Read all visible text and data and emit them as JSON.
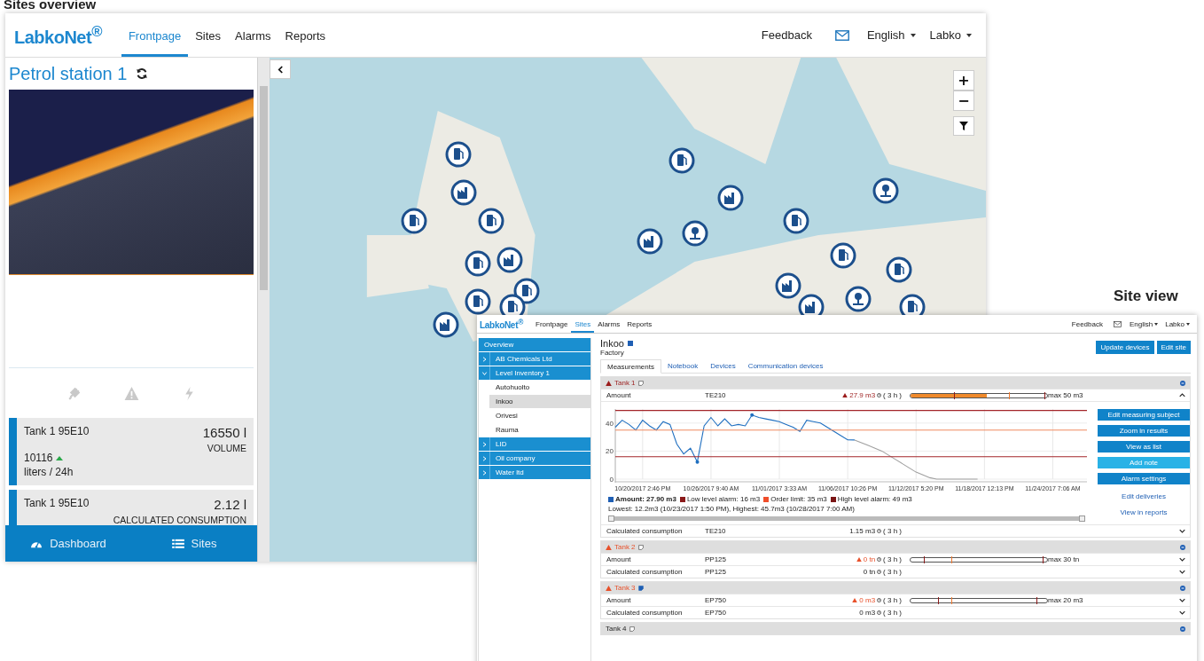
{
  "page_heading": "Sites overview",
  "overview_window": {
    "logo": "LabkoNet$^{®}$",
    "nav": [
      {
        "label": "Frontpage",
        "selected": true
      },
      {
        "label": "Sites",
        "selected": false
      },
      {
        "label": "Alarms",
        "selected": false
      },
      {
        "label": "Reports",
        "selected": false
      }
    ],
    "header_links": {
      "feedback": "Feedback",
      "language": "English",
      "user": "Labko"
    },
    "site_title": "Petrol station 1",
    "cards": [
      {
        "name": "Tank 1 95E10",
        "value": "16550 l",
        "caption": "VOLUME",
        "change": "10116",
        "trend_up": true,
        "change_unit": "liters / 24h"
      },
      {
        "name": "Tank 1 95E10",
        "value": "2.12 l",
        "caption": "CALCULATED CONSUMPTION"
      }
    ],
    "bottom_nav": [
      {
        "label": "Dashboard",
        "kind": "dashboard"
      },
      {
        "label": "Sites",
        "kind": "list"
      }
    ],
    "map_controls": {
      "zoom_in": "+",
      "zoom_out": "−"
    }
  },
  "site_view_label": "Site view",
  "site_window": {
    "logo": "LabkoNet$^{®}$",
    "nav": [
      {
        "label": "Frontpage",
        "selected": false
      },
      {
        "label": "Sites",
        "selected": true
      },
      {
        "label": "Alarms",
        "selected": false
      },
      {
        "label": "Reports",
        "selected": false
      }
    ],
    "header_links": {
      "feedback": "Feedback",
      "language": "English",
      "user": "Labko"
    },
    "sidebar": [
      {
        "label": "Overview",
        "kind": "header"
      },
      {
        "label": "AB Chemicals Ltd",
        "kind": "group",
        "expanded": false
      },
      {
        "label": "Level Inventory 1",
        "kind": "group",
        "expanded": true,
        "children": [
          {
            "label": "Autohuolto",
            "selected": false
          },
          {
            "label": "Inkoo",
            "selected": true
          },
          {
            "label": "Orivesi",
            "selected": false
          },
          {
            "label": "Rauma",
            "selected": false
          }
        ]
      },
      {
        "label": "LID",
        "kind": "group",
        "expanded": false
      },
      {
        "label": "Oil company",
        "kind": "group",
        "expanded": false
      },
      {
        "label": "Water ltd",
        "kind": "group",
        "expanded": false
      }
    ],
    "title": "Inkoo",
    "subtitle": "Factory",
    "actions": [
      "Update devices",
      "Edit site"
    ],
    "tabs": [
      {
        "label": "Measurements",
        "selected": true
      },
      {
        "label": "Notebook",
        "selected": false
      },
      {
        "label": "Devices",
        "selected": false
      },
      {
        "label": "Communication devices",
        "selected": false
      }
    ],
    "tanks": [
      {
        "name": "Tank 1",
        "alarm": true,
        "color": "#9b1c1c",
        "note_filled": false,
        "rows": [
          {
            "label": "Amount",
            "device": "TE210",
            "reading": "27.9 m3",
            "alarm": true,
            "age": "( 3 h )",
            "level": 0.56,
            "markers": [
              {
                "level": 0.32,
                "kind": "alarm"
              },
              {
                "level": 0.72,
                "kind": "order"
              },
              {
                "level": 0.98,
                "kind": "alarm"
              }
            ],
            "max": "max 50 m3",
            "expanded": true,
            "details": {
              "chart_data": {
                "type": "line",
                "categories": [
                  null,
                  null,
                  null,
                  null,
                  "10/20/2017 2:46 PM",
                  null,
                  null,
                  null,
                  null,
                  null,
                  null,
                  null,
                  null,
                  null,
                  "10/26/2017 9:40 AM",
                  null,
                  null,
                  null,
                  null,
                  null,
                  null,
                  null,
                  null,
                  null,
                  "11/01/2017 3:33 AM",
                  null,
                  null,
                  null,
                  null,
                  null,
                  null,
                  null,
                  null,
                  null,
                  "11/06/2017 10:26 PM",
                  null,
                  null,
                  null,
                  null,
                  null,
                  null,
                  null,
                  null,
                  null,
                  "11/12/2017 5:20 PM",
                  null,
                  null,
                  null,
                  null,
                  null,
                  null,
                  null,
                  null,
                  null,
                  "11/18/2017 12:13 PM",
                  null,
                  null,
                  null,
                  null,
                  null,
                  null,
                  null,
                  null,
                  null,
                  "11/24/2017 7:06 AM",
                  null,
                  null,
                  null,
                  null,
                  null
                ],
                "series": [
                  {
                    "color": "#1f6fc0",
                    "values": [
                      37,
                      42,
                      39,
                      35,
                      42,
                      38,
                      35,
                      41,
                      39,
                      25,
                      18,
                      22,
                      12.2,
                      38,
                      44,
                      38,
                      43,
                      38,
                      39,
                      38,
                      45.7,
                      44,
                      43,
                      42,
                      41,
                      39,
                      37,
                      34,
                      42,
                      41,
                      40,
                      37,
                      34,
                      31,
                      28,
                      27.9,
                      null,
                      null,
                      null,
                      null,
                      null,
                      null,
                      null,
                      null,
                      null,
                      null,
                      null,
                      null,
                      null,
                      null,
                      null,
                      null,
                      null,
                      null,
                      null,
                      null,
                      null,
                      null,
                      null,
                      null,
                      null,
                      null,
                      null,
                      null,
                      null,
                      null,
                      null,
                      null,
                      null,
                      null
                    ]
                  },
                  {
                    "color": "#a0a0a0",
                    "values": [
                      null,
                      null,
                      null,
                      null,
                      null,
                      null,
                      null,
                      null,
                      null,
                      null,
                      null,
                      null,
                      null,
                      null,
                      null,
                      null,
                      null,
                      null,
                      null,
                      null,
                      null,
                      null,
                      null,
                      null,
                      null,
                      null,
                      null,
                      null,
                      null,
                      null,
                      null,
                      null,
                      null,
                      null,
                      null,
                      27.9,
                      26,
                      24,
                      22,
                      20,
                      17,
                      14,
                      11,
                      8,
                      5,
                      3,
                      1,
                      0,
                      0,
                      0,
                      0,
                      0,
                      0,
                      0,
                      null,
                      null,
                      null,
                      null,
                      null,
                      null,
                      null,
                      null,
                      null,
                      null,
                      null,
                      null,
                      null,
                      null,
                      null,
                      null
                    ]
                  },
                  {
                    "color": "#a3262a",
                    "values": [
                      16,
                      16,
                      16,
                      16,
                      16,
                      16,
                      16,
                      16,
                      16,
                      16,
                      16,
                      16,
                      16,
                      16,
                      16,
                      16,
                      16,
                      16,
                      16,
                      16,
                      16,
                      16,
                      16,
                      16,
                      16,
                      16,
                      16,
                      16,
                      16,
                      16,
                      16,
                      16,
                      16,
                      16,
                      16,
                      16,
                      16,
                      16,
                      16,
                      16,
                      16,
                      16,
                      16,
                      16,
                      16,
                      16,
                      16,
                      16,
                      16,
                      16,
                      16,
                      16,
                      16,
                      16,
                      16,
                      16,
                      16,
                      16,
                      16,
                      16,
                      16,
                      16,
                      16,
                      16,
                      16,
                      16,
                      16,
                      16,
                      16,
                      16
                    ]
                  },
                  {
                    "color": "#f08a5f",
                    "values": [
                      35,
                      35,
                      35,
                      35,
                      35,
                      35,
                      35,
                      35,
                      35,
                      35,
                      35,
                      35,
                      35,
                      35,
                      35,
                      35,
                      35,
                      35,
                      35,
                      35,
                      35,
                      35,
                      35,
                      35,
                      35,
                      35,
                      35,
                      35,
                      35,
                      35,
                      35,
                      35,
                      35,
                      35,
                      35,
                      35,
                      35,
                      35,
                      35,
                      35,
                      35,
                      35,
                      35,
                      35,
                      35,
                      35,
                      35,
                      35,
                      35,
                      35,
                      35,
                      35,
                      35,
                      35,
                      35,
                      35,
                      35,
                      35,
                      35,
                      35,
                      35,
                      35,
                      35,
                      35,
                      35,
                      35,
                      35,
                      35,
                      35,
                      35
                    ]
                  },
                  {
                    "color": "#a3262a",
                    "values": [
                      49,
                      49,
                      49,
                      49,
                      49,
                      49,
                      49,
                      49,
                      49,
                      49,
                      49,
                      49,
                      49,
                      49,
                      49,
                      49,
                      49,
                      49,
                      49,
                      49,
                      49,
                      49,
                      49,
                      49,
                      49,
                      49,
                      49,
                      49,
                      49,
                      49,
                      49,
                      49,
                      49,
                      49,
                      49,
                      49,
                      49,
                      49,
                      49,
                      49,
                      49,
                      49,
                      49,
                      49,
                      49,
                      49,
                      49,
                      49,
                      49,
                      49,
                      49,
                      49,
                      49,
                      49,
                      49,
                      49,
                      49,
                      49,
                      49,
                      49,
                      49,
                      49,
                      49,
                      49,
                      49,
                      49,
                      49,
                      49,
                      49,
                      49
                    ]
                  }
                ],
                "ylim": [
                  0,
                  50
                ],
                "yticks": [
                  0,
                  20,
                  40
                ],
                "grid": true
              },
              "legend": [
                {
                  "label": "Amount: 27.90 m3",
                  "kind": "current",
                  "color": "#1f5fb4"
                },
                {
                  "label": "Low level alarm: 16 m3",
                  "kind": "limit",
                  "color": "#8b1a1a"
                },
                {
                  "label": "Order limit: 35 m3",
                  "kind": "limit",
                  "color": "#f04e2b"
                },
                {
                  "label": "High level alarm: 49 m3",
                  "kind": "limit",
                  "color": "#7a1515"
                }
              ],
              "stats": "Lowest: 12.2m3 (10/23/2017 1:50 PM), Highest: 45.7m3 (10/28/2017 7:00 AM)",
              "range_slider": {
                "level": 1
              },
              "actions": [
                {
                  "label": "Edit measuring subject",
                  "kind": "button"
                },
                {
                  "label": "Zoom in results",
                  "kind": "button"
                },
                {
                  "label": "View as list",
                  "kind": "button"
                },
                {
                  "label": "Add note",
                  "kind": "light"
                },
                {
                  "label": "Alarm settings",
                  "kind": "button"
                },
                {
                  "label": "Edit deliveries",
                  "kind": "link"
                },
                {
                  "label": "View in reports",
                  "kind": "link"
                }
              ]
            }
          },
          {
            "label": "Calculated consumption",
            "device": "TE210",
            "reading": "1.15 m3",
            "alarm": false,
            "age": "( 3 h )",
            "expanded": false
          }
        ]
      },
      {
        "name": "Tank 2",
        "alarm": true,
        "color": "#e8502a",
        "note_filled": false,
        "rows": [
          {
            "label": "Amount",
            "device": "PP125",
            "reading": "0 tn",
            "alarm": true,
            "age": "( 3 h )",
            "markers": [
              {
                "level": 0.1,
                "kind": "alarm"
              },
              {
                "level": 0.3,
                "kind": "order"
              },
              {
                "level": 0.97,
                "kind": "alarm"
              }
            ],
            "max": "max 30 tn",
            "expanded": false
          },
          {
            "label": "Calculated consumption",
            "device": "PP125",
            "reading": "0 tn",
            "alarm": false,
            "age": "( 3 h )",
            "expanded": false
          }
        ]
      },
      {
        "name": "Tank 3",
        "alarm": true,
        "color": "#e8502a",
        "note_filled": true,
        "rows": [
          {
            "label": "Amount",
            "device": "EP750",
            "reading": "0 m3",
            "alarm": true,
            "age": "( 3 h )",
            "markers": [
              {
                "level": 0.2,
                "kind": "alarm"
              },
              {
                "level": 0.3,
                "kind": "order"
              },
              {
                "level": 0.92,
                "kind": "alarm"
              }
            ],
            "max": "max 20 m3",
            "expanded": false
          },
          {
            "label": "Calculated consumption",
            "device": "EP750",
            "reading": "0 m3",
            "alarm": false,
            "age": "( 3 h )",
            "expanded": false
          }
        ]
      },
      {
        "name": "Tank 4",
        "alarm": false,
        "note_filled": false
      }
    ]
  }
}
